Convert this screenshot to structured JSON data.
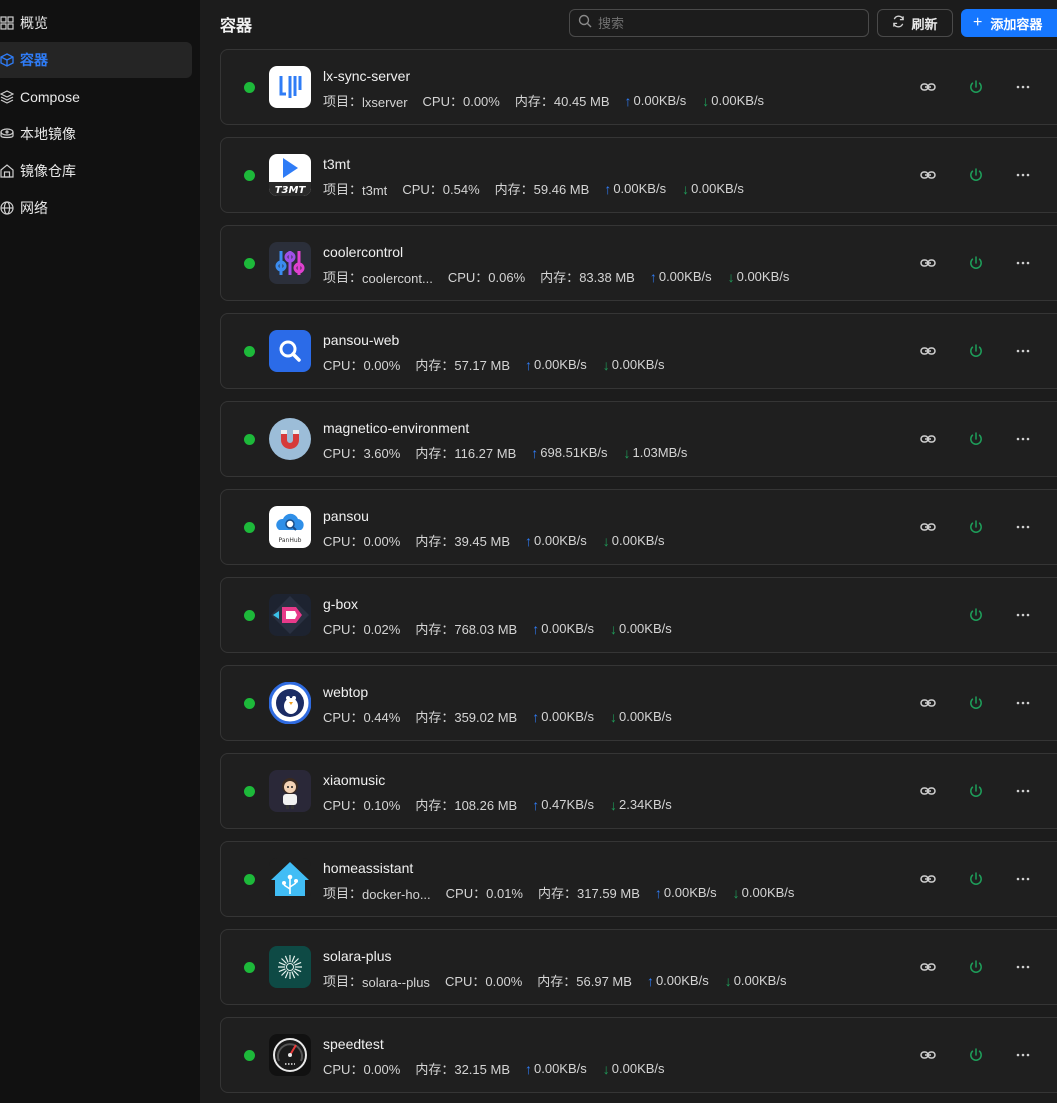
{
  "sidebar": {
    "items": [
      {
        "label": "概览",
        "icon": "grid-icon",
        "active": false
      },
      {
        "label": "容器",
        "icon": "cube-icon",
        "active": true
      },
      {
        "label": "Compose",
        "icon": "layers-icon",
        "active": false
      },
      {
        "label": "本地镜像",
        "icon": "disk-icon",
        "active": false
      },
      {
        "label": "镜像仓库",
        "icon": "warehouse-icon",
        "active": false
      },
      {
        "label": "网络",
        "icon": "globe-icon",
        "active": false
      }
    ]
  },
  "header": {
    "title": "容器",
    "search_placeholder": "搜索",
    "refresh_label": "刷新",
    "add_label": "添加容器",
    "add_icon": "+"
  },
  "labels": {
    "project": "项目：",
    "cpu": "CPU：",
    "memory": "内存："
  },
  "colors": {
    "accent": "#1677ff",
    "running": "#1db93a",
    "upload": "#2f7cf6",
    "download": "#1e9e5a"
  },
  "containers": [
    {
      "name": "lx-sync-server",
      "project": "lxserver",
      "cpu": "0.00%",
      "memory": "40.45 MB",
      "up": "0.00KB/s",
      "down": "0.00KB/s",
      "has_link": true,
      "icon": "lx-logo-icon"
    },
    {
      "name": "t3mt",
      "project": "t3mt",
      "cpu": "0.54%",
      "memory": "59.46 MB",
      "up": "0.00KB/s",
      "down": "0.00KB/s",
      "has_link": true,
      "icon": "t3mt-logo-icon",
      "icon_text": "T3MT"
    },
    {
      "name": "coolercontrol",
      "project": "coolercont...",
      "cpu": "0.06%",
      "memory": "83.38 MB",
      "up": "0.00KB/s",
      "down": "0.00KB/s",
      "has_link": true,
      "icon": "sliders-logo-icon"
    },
    {
      "name": "pansou-web",
      "project": null,
      "cpu": "0.00%",
      "memory": "57.17 MB",
      "up": "0.00KB/s",
      "down": "0.00KB/s",
      "has_link": true,
      "icon": "magnifier-logo-icon"
    },
    {
      "name": "magnetico-environment",
      "project": null,
      "cpu": "3.60%",
      "memory": "116.27 MB",
      "up": "698.51KB/s",
      "down": "1.03MB/s",
      "has_link": true,
      "icon": "magnet-logo-icon"
    },
    {
      "name": "pansou",
      "project": null,
      "cpu": "0.00%",
      "memory": "39.45 MB",
      "up": "0.00KB/s",
      "down": "0.00KB/s",
      "has_link": true,
      "icon": "panhub-logo-icon",
      "icon_text": "PanHub"
    },
    {
      "name": "g-box",
      "project": null,
      "cpu": "0.02%",
      "memory": "768.03 MB",
      "up": "0.00KB/s",
      "down": "0.00KB/s",
      "has_link": false,
      "icon": "gbox-logo-icon"
    },
    {
      "name": "webtop",
      "project": null,
      "cpu": "0.44%",
      "memory": "359.02 MB",
      "up": "0.00KB/s",
      "down": "0.00KB/s",
      "has_link": true,
      "icon": "penguin-logo-icon"
    },
    {
      "name": "xiaomusic",
      "project": null,
      "cpu": "0.10%",
      "memory": "108.26 MB",
      "up": "0.47KB/s",
      "down": "2.34KB/s",
      "has_link": true,
      "icon": "character-logo-icon"
    },
    {
      "name": "homeassistant",
      "project": "docker-ho...",
      "cpu": "0.01%",
      "memory": "317.59 MB",
      "up": "0.00KB/s",
      "down": "0.00KB/s",
      "has_link": true,
      "icon": "house-logo-icon"
    },
    {
      "name": "solara-plus",
      "project": "solara--plus",
      "cpu": "0.00%",
      "memory": "56.97 MB",
      "up": "0.00KB/s",
      "down": "0.00KB/s",
      "has_link": true,
      "icon": "sunburst-logo-icon"
    },
    {
      "name": "speedtest",
      "project": null,
      "cpu": "0.00%",
      "memory": "32.15 MB",
      "up": "0.00KB/s",
      "down": "0.00KB/s",
      "has_link": true,
      "icon": "gauge-logo-icon"
    }
  ]
}
